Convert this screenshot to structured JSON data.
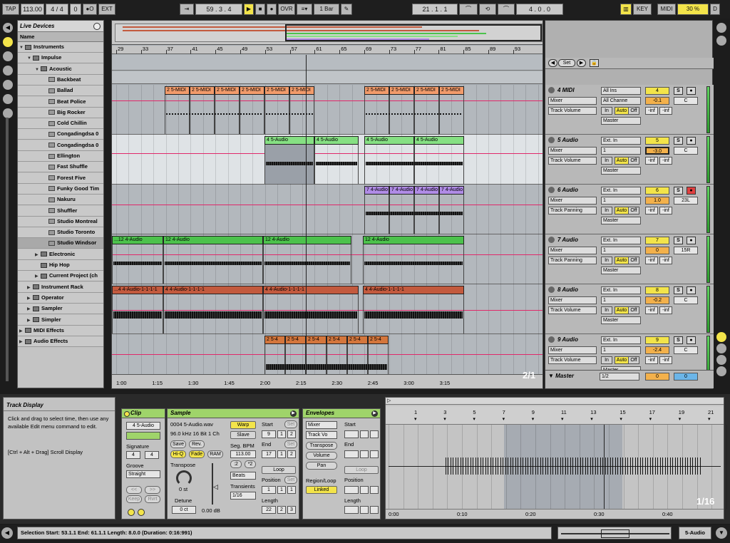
{
  "transport": {
    "tap": "TAP",
    "tempo": "113.00",
    "signature": "4 / 4",
    "metronome": "0",
    "rec_dot": "●O",
    "ext": "EXT",
    "follow": "⇥",
    "position": "59 .  3 .  4",
    "play": "▶",
    "stop": "■",
    "record": "●",
    "ovr": "OVR",
    "quantize": "1 Bar",
    "draw": "✎",
    "loop_start": "21 .  1 .  1",
    "loop_length": "4 .  0 .  0",
    "key": "KEY",
    "midi": "MIDI",
    "cpu": "30 %",
    "d": "D"
  },
  "browser": {
    "title": "Live Devices",
    "col_name": "Name",
    "items": [
      {
        "label": "Instruments",
        "indent": 0,
        "tri": "▼",
        "type": "folder"
      },
      {
        "label": "Impulse",
        "indent": 1,
        "tri": "▼",
        "type": "folder"
      },
      {
        "label": "Acoustic",
        "indent": 2,
        "tri": "▼",
        "type": "folder"
      },
      {
        "label": "Backbeat",
        "indent": 3,
        "tri": "",
        "type": "preset"
      },
      {
        "label": "Ballad",
        "indent": 3,
        "tri": "",
        "type": "preset"
      },
      {
        "label": "Beat Police",
        "indent": 3,
        "tri": "",
        "type": "preset"
      },
      {
        "label": "Big Rocker",
        "indent": 3,
        "tri": "",
        "type": "preset"
      },
      {
        "label": "Cold Chillin",
        "indent": 3,
        "tri": "",
        "type": "preset"
      },
      {
        "label": "Congadingdsa 0",
        "indent": 3,
        "tri": "",
        "type": "preset"
      },
      {
        "label": "Congadingdsa 0",
        "indent": 3,
        "tri": "",
        "type": "preset"
      },
      {
        "label": "Ellington",
        "indent": 3,
        "tri": "",
        "type": "preset"
      },
      {
        "label": "Fast Shuffle",
        "indent": 3,
        "tri": "",
        "type": "preset"
      },
      {
        "label": "Forest Five",
        "indent": 3,
        "tri": "",
        "type": "preset"
      },
      {
        "label": "Funky Good Tim",
        "indent": 3,
        "tri": "",
        "type": "preset"
      },
      {
        "label": "Nakuru",
        "indent": 3,
        "tri": "",
        "type": "preset"
      },
      {
        "label": "Shuffler",
        "indent": 3,
        "tri": "",
        "type": "preset"
      },
      {
        "label": "Studio Montreal",
        "indent": 3,
        "tri": "",
        "type": "preset"
      },
      {
        "label": "Studio Toronto",
        "indent": 3,
        "tri": "",
        "type": "preset"
      },
      {
        "label": "Studio Windsor",
        "indent": 3,
        "tri": "",
        "type": "preset",
        "selected": true
      },
      {
        "label": "Electronic",
        "indent": 2,
        "tri": "▶",
        "type": "folder"
      },
      {
        "label": "Hip Hop",
        "indent": 2,
        "tri": "",
        "type": "folder"
      },
      {
        "label": "Current Project (ch",
        "indent": 2,
        "tri": "▶",
        "type": "folder"
      },
      {
        "label": "Instrument Rack",
        "indent": 1,
        "tri": "▶",
        "type": "folder"
      },
      {
        "label": "Operator",
        "indent": 1,
        "tri": "▶",
        "type": "folder"
      },
      {
        "label": "Sampler",
        "indent": 1,
        "tri": "▶",
        "type": "folder"
      },
      {
        "label": "Simpler",
        "indent": 1,
        "tri": "▶",
        "type": "folder"
      },
      {
        "label": "MIDI Effects",
        "indent": 0,
        "tri": "▶",
        "type": "folder"
      },
      {
        "label": "Audio Effects",
        "indent": 0,
        "tri": "▶",
        "type": "folder"
      }
    ]
  },
  "ruler": {
    "bars": [
      "29",
      "33",
      "37",
      "41",
      "45",
      "49",
      "53",
      "57",
      "61",
      "65",
      "69",
      "73",
      "77",
      "81",
      "85",
      "89",
      "93"
    ],
    "times": [
      "1:00",
      "1:15",
      "1:30",
      "1:45",
      "2:00",
      "2:15",
      "2:30",
      "2:45",
      "3:00",
      "3:15"
    ],
    "zoom": "2/1"
  },
  "locators": {
    "set": "Set"
  },
  "tracks": [
    {
      "name": "4 MIDI",
      "color": "#f29b6b",
      "clip_label": "2 5-MIDI",
      "input": "All Ins",
      "input2": "All Channe",
      "out_type": "Mixer",
      "device": "Track Volume",
      "monitor": [
        "In",
        "Auto",
        "Off"
      ],
      "master": "Master",
      "number": "4",
      "vol": "-0.1",
      "pan": "C",
      "send1": "-inf",
      "send2": "-inf"
    },
    {
      "name": "5 Audio",
      "color": "#86e083",
      "clip_label": "4 5-Audio",
      "input": "Ext. In",
      "input2": "1",
      "out_type": "Mixer",
      "device": "Track Volume",
      "monitor": [
        "In",
        "Auto",
        "Off"
      ],
      "master": "Master",
      "number": "5",
      "vol": "-3.0",
      "pan": "C",
      "send1": "-inf",
      "send2": "-inf"
    },
    {
      "name": "6 Audio",
      "color": "#b08be6",
      "clip_label": "7 4-Audio",
      "input": "Ext. In",
      "input2": "1",
      "out_type": "Mixer",
      "device": "Track Panning",
      "monitor": [
        "In",
        "Auto",
        "Off"
      ],
      "master": "Master",
      "number": "6",
      "vol": "1.0",
      "pan": "23L",
      "send1": "-inf",
      "send2": "-inf"
    },
    {
      "name": "7 Audio",
      "color": "#4cc24c",
      "clip_label": "12 4-Audio",
      "clip_label0": "...12 4-Audio",
      "input": "Ext. In",
      "input2": "1",
      "out_type": "Mixer",
      "device": "Track Panning",
      "monitor": [
        "In",
        "Auto",
        "Off"
      ],
      "master": "Master",
      "number": "7",
      "vol": "0",
      "pan": "15R",
      "send1": "-inf",
      "send2": "-inf"
    },
    {
      "name": "8 Audio",
      "color": "#c35a3e",
      "clip_label": "4 4-Audio-1-1-1-1",
      "clip_label0": "...4 4-Audio-1-1-1-1",
      "input": "Ext. In",
      "input2": "1",
      "out_type": "Mixer",
      "device": "Track Volume",
      "monitor": [
        "In",
        "Auto",
        "Off"
      ],
      "master": "Master",
      "number": "8",
      "vol": "-0.2",
      "pan": "C",
      "send1": "-inf",
      "send2": "-inf"
    },
    {
      "name": "9 Audio",
      "color": "#d4763c",
      "clip_label": "2 5-4",
      "input": "Ext. In",
      "input2": "1",
      "out_type": "Mixer",
      "device": "Track Volume",
      "monitor": [
        "In",
        "Auto",
        "Off"
      ],
      "master": "Master",
      "number": "9",
      "vol": "-2.4",
      "pan": "C",
      "send1": "-inf",
      "send2": "-inf"
    }
  ],
  "master": {
    "name": "Master",
    "sel": "1/2",
    "vol": "0",
    "pan": "0"
  },
  "info": {
    "title": "Track Display",
    "text1": "Click and drag to select time, then use any available Edit menu command to edit.",
    "text2": "[Ctrl + Alt + Drag] Scroll Display"
  },
  "clipbox": {
    "title": "Clip",
    "name": "4 5-Audio",
    "signature_label": "Signature",
    "sig_num": "4",
    "sig_den": "4",
    "groove_label": "Groove",
    "groove": "Straight",
    "nav": [
      "<<",
      ">>",
      "Keep",
      "Rvrt"
    ]
  },
  "sample": {
    "title": "Sample",
    "file": "0004 5-Audio.wav",
    "format": "96.0 kHz 16 Bit 1 Ch",
    "save": "Save",
    "rev": "Rev.",
    "hiq": "Hi-Q",
    "fade": "Fade",
    "ram": "RAM",
    "transpose_label": "Transpose",
    "transpose": "0 st",
    "detune_label": "Detune",
    "detune": "0 ct",
    "gain": "0.00 dB",
    "warp": "Warp",
    "slave": "Slave",
    "seg_bpm_label": "Seg. BPM",
    "seg_bpm": "113.00",
    "half": ":2",
    "double": "*2",
    "warp_mode": "Beats",
    "transients_label": "Transients",
    "transients": "1/16",
    "start_label": "Start",
    "start": [
      "9",
      "1",
      "2"
    ],
    "end_label": "End",
    "end": [
      "17",
      "1",
      "2"
    ],
    "loop": "Loop",
    "position_label": "Position",
    "position": [
      "1",
      "1",
      "1"
    ],
    "length_label": "Length",
    "length": [
      "22",
      "2",
      "3"
    ],
    "set": "Set"
  },
  "envelopes": {
    "title": "Envelopes",
    "sel1": "Mixer",
    "sel2": "Track Vo",
    "buttons": [
      "Transpose",
      "Volume",
      "Pan"
    ],
    "region_label": "Region/Loop",
    "linked": "Linked",
    "start_label": "Start",
    "end_label": "End",
    "loop": "Loop",
    "position_label": "Position",
    "length_label": "Length"
  },
  "sample_editor": {
    "bars": [
      "1",
      "3",
      "5",
      "7",
      "9",
      "11",
      "13",
      "15",
      "17",
      "19",
      "21",
      "23"
    ],
    "times": [
      "0:00",
      "0:10",
      "0:20",
      "0:30",
      "0:40"
    ],
    "zoom": "1/16"
  },
  "status": {
    "selection": "Selection Start: 53.1.1   End: 61.1.1   Length: 8.0.0  (Duration: 0:16:991)",
    "track": "5-Audio"
  }
}
